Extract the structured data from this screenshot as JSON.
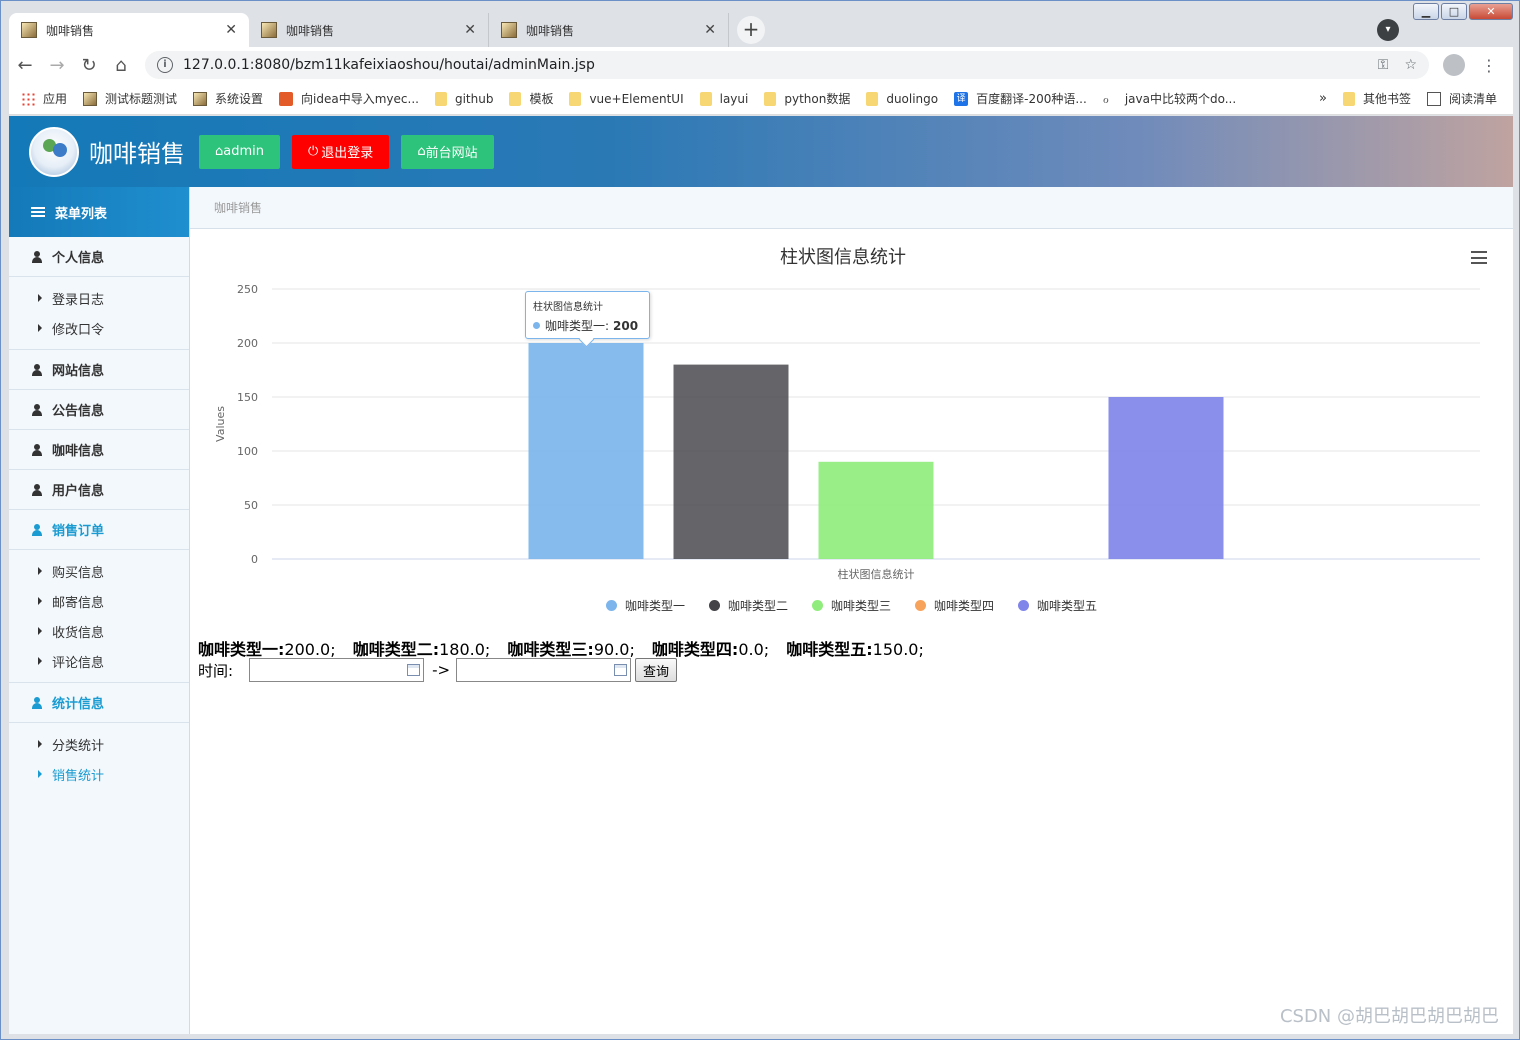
{
  "browser": {
    "tabs": [
      {
        "title": "咖啡销售",
        "active": true
      },
      {
        "title": "咖啡销售",
        "active": false
      },
      {
        "title": "咖啡销售",
        "active": false
      }
    ],
    "url": "127.0.0.1:8080/bzm11kafeixiaoshou/houtai/adminMain.jsp",
    "bookmarks": [
      "应用",
      "测试标题测试",
      "系统设置",
      "向idea中导入myec...",
      "github",
      "模板",
      "vue+ElementUI",
      "layui",
      "python数据",
      "duolingo",
      "百度翻译-200种语...",
      "java中比较两个do..."
    ],
    "bookmarks_more": "»",
    "other_bookmarks": "其他书签",
    "reading_list": "阅读清单"
  },
  "header": {
    "brand": "咖啡销售",
    "buttons": {
      "admin": "admin",
      "logout": "退出登录",
      "frontsite": "前台网站"
    }
  },
  "sidebar": {
    "title": "菜单列表",
    "sections": [
      {
        "label": "个人信息",
        "active": false,
        "items": [
          {
            "label": "登录日志",
            "active": false
          },
          {
            "label": "修改口令",
            "active": false
          }
        ]
      },
      {
        "label": "网站信息",
        "active": false,
        "items": []
      },
      {
        "label": "公告信息",
        "active": false,
        "items": []
      },
      {
        "label": "咖啡信息",
        "active": false,
        "items": []
      },
      {
        "label": "用户信息",
        "active": false,
        "items": []
      },
      {
        "label": "销售订单",
        "active": true,
        "items": [
          {
            "label": "购买信息",
            "active": false
          },
          {
            "label": "邮寄信息",
            "active": false
          },
          {
            "label": "收货信息",
            "active": false
          },
          {
            "label": "评论信息",
            "active": false
          }
        ]
      },
      {
        "label": "统计信息",
        "active": true,
        "items": [
          {
            "label": "分类统计",
            "active": false
          },
          {
            "label": "销售统计",
            "active": true
          }
        ]
      }
    ]
  },
  "breadcrumb": "咖啡销售",
  "chart_data": {
    "type": "bar",
    "title": "柱状图信息统计",
    "xlabel": "柱状图信息统计",
    "ylabel": "Values",
    "ylim": [
      0,
      250
    ],
    "yticks": [
      0,
      50,
      100,
      150,
      200,
      250
    ],
    "grid": true,
    "legend_position": "bottom",
    "series": [
      {
        "name": "咖啡类型一",
        "values": [
          200
        ],
        "color": "#7cb5ec"
      },
      {
        "name": "咖啡类型二",
        "values": [
          180
        ],
        "color": "#434348"
      },
      {
        "name": "咖啡类型三",
        "values": [
          90
        ],
        "color": "#90ed7d"
      },
      {
        "name": "咖啡类型四",
        "values": [
          0
        ],
        "color": "#f7a35c"
      },
      {
        "name": "咖啡类型五",
        "values": [
          150
        ],
        "color": "#8085e9"
      }
    ],
    "tooltip": {
      "title": "柱状图信息统计",
      "series": "咖啡类型一",
      "label": "咖啡类型一:",
      "value": "200"
    }
  },
  "stats": [
    {
      "label": "咖啡类型一:",
      "value": "200.0;"
    },
    {
      "label": "咖啡类型二:",
      "value": "180.0;"
    },
    {
      "label": "咖啡类型三:",
      "value": "90.0;"
    },
    {
      "label": "咖啡类型四:",
      "value": "0.0;"
    },
    {
      "label": "咖啡类型五:",
      "value": "150.0;"
    }
  ],
  "filter": {
    "label": "时间:",
    "arrow": "->",
    "query": "查询",
    "start": "",
    "end": ""
  },
  "watermark": "CSDN @胡巴胡巴胡巴胡巴"
}
